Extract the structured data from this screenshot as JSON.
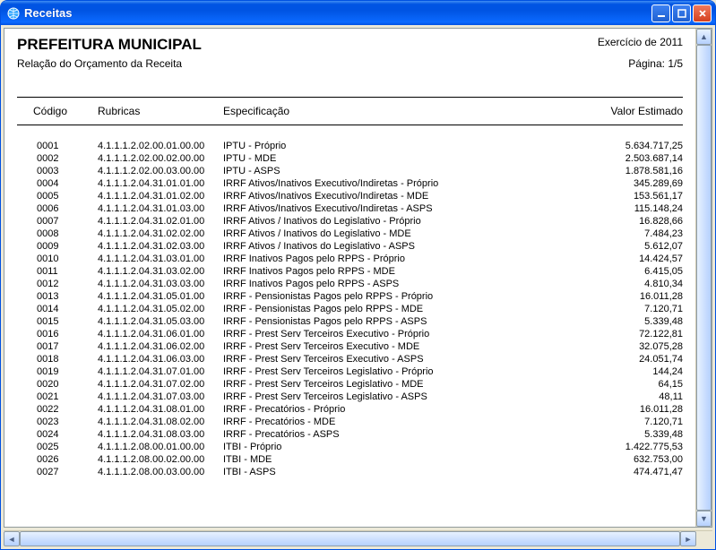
{
  "window": {
    "title": "Receitas"
  },
  "report": {
    "org": "PREFEITURA MUNICIPAL",
    "subtitle": "Relação do Orçamento da Receita",
    "exercise": "Exercício de 2011",
    "page": "Página: 1/5"
  },
  "columns": {
    "codigo": "Código",
    "rubricas": "Rubricas",
    "especificacao": "Especificação",
    "valor": "Valor Estimado"
  },
  "rows": [
    {
      "codigo": "0001",
      "rubrica": "4.1.1.1.2.02.00.01.00.00",
      "espec": "IPTU - Próprio",
      "valor": "5.634.717,25"
    },
    {
      "codigo": "0002",
      "rubrica": "4.1.1.1.2.02.00.02.00.00",
      "espec": "IPTU - MDE",
      "valor": "2.503.687,14"
    },
    {
      "codigo": "0003",
      "rubrica": "4.1.1.1.2.02.00.03.00.00",
      "espec": "IPTU - ASPS",
      "valor": "1.878.581,16"
    },
    {
      "codigo": "0004",
      "rubrica": "4.1.1.1.2.04.31.01.01.00",
      "espec": "IRRF Ativos/Inativos Executivo/Indiretas - Próprio",
      "valor": "345.289,69"
    },
    {
      "codigo": "0005",
      "rubrica": "4.1.1.1.2.04.31.01.02.00",
      "espec": "IRRF Ativos/Inativos Executivo/Indiretas - MDE",
      "valor": "153.561,17"
    },
    {
      "codigo": "0006",
      "rubrica": "4.1.1.1.2.04.31.01.03.00",
      "espec": "IRRF Ativos/Inativos Executivo/Indiretas - ASPS",
      "valor": "115.148,24"
    },
    {
      "codigo": "0007",
      "rubrica": "4.1.1.1.2.04.31.02.01.00",
      "espec": "IRRF Ativos / Inativos do Legislativo - Próprio",
      "valor": "16.828,66"
    },
    {
      "codigo": "0008",
      "rubrica": "4.1.1.1.2.04.31.02.02.00",
      "espec": "IRRF Ativos / Inativos do Legislativo - MDE",
      "valor": "7.484,23"
    },
    {
      "codigo": "0009",
      "rubrica": "4.1.1.1.2.04.31.02.03.00",
      "espec": "IRRF Ativos / Inativos do Legislativo -  ASPS",
      "valor": "5.612,07"
    },
    {
      "codigo": "0010",
      "rubrica": "4.1.1.1.2.04.31.03.01.00",
      "espec": "IRRF Inativos Pagos pelo RPPS - Próprio",
      "valor": "14.424,57"
    },
    {
      "codigo": "0011",
      "rubrica": "4.1.1.1.2.04.31.03.02.00",
      "espec": "IRRF Inativos Pagos pelo RPPS - MDE",
      "valor": "6.415,05"
    },
    {
      "codigo": "0012",
      "rubrica": "4.1.1.1.2.04.31.03.03.00",
      "espec": "IRRF Inativos Pagos pelo RPPS - ASPS",
      "valor": "4.810,34"
    },
    {
      "codigo": "0013",
      "rubrica": "4.1.1.1.2.04.31.05.01.00",
      "espec": "IRRF - Pensionistas Pagos pelo RPPS - Próprio",
      "valor": "16.011,28"
    },
    {
      "codigo": "0014",
      "rubrica": "4.1.1.1.2.04.31.05.02.00",
      "espec": "IRRF - Pensionistas Pagos pelo RPPS - MDE",
      "valor": "7.120,71"
    },
    {
      "codigo": "0015",
      "rubrica": "4.1.1.1.2.04.31.05.03.00",
      "espec": "IRRF - Pensionistas Pagos pelo RPPS - ASPS",
      "valor": "5.339,48"
    },
    {
      "codigo": "0016",
      "rubrica": "4.1.1.1.2.04.31.06.01.00",
      "espec": "IRRF - Prest Serv Terceiros Executivo - Próprio",
      "valor": "72.122,81"
    },
    {
      "codigo": "0017",
      "rubrica": "4.1.1.1.2.04.31.06.02.00",
      "espec": "IRRF - Prest Serv Terceiros Executivo - MDE",
      "valor": "32.075,28"
    },
    {
      "codigo": "0018",
      "rubrica": "4.1.1.1.2.04.31.06.03.00",
      "espec": "IRRF - Prest Serv Terceiros Executivo - ASPS",
      "valor": "24.051,74"
    },
    {
      "codigo": "0019",
      "rubrica": "4.1.1.1.2.04.31.07.01.00",
      "espec": "IRRF - Prest Serv Terceiros Legislativo - Próprio",
      "valor": "144,24"
    },
    {
      "codigo": "0020",
      "rubrica": "4.1.1.1.2.04.31.07.02.00",
      "espec": "IRRF - Prest Serv Terceiros Legislativo - MDE",
      "valor": "64,15"
    },
    {
      "codigo": "0021",
      "rubrica": "4.1.1.1.2.04.31.07.03.00",
      "espec": "IRRF - Prest Serv Terceiros Legislativo - ASPS",
      "valor": "48,11"
    },
    {
      "codigo": "0022",
      "rubrica": "4.1.1.1.2.04.31.08.01.00",
      "espec": "IRRF - Precatórios - Próprio",
      "valor": "16.011,28"
    },
    {
      "codigo": "0023",
      "rubrica": "4.1.1.1.2.04.31.08.02.00",
      "espec": "IRRF - Precatórios - MDE",
      "valor": "7.120,71"
    },
    {
      "codigo": "0024",
      "rubrica": "4.1.1.1.2.04.31.08.03.00",
      "espec": "IRRF - Precatórios - ASPS",
      "valor": "5.339,48"
    },
    {
      "codigo": "0025",
      "rubrica": "4.1.1.1.2.08.00.01.00.00",
      "espec": "ITBI - Próprio",
      "valor": "1.422.775,53"
    },
    {
      "codigo": "0026",
      "rubrica": "4.1.1.1.2.08.00.02.00.00",
      "espec": "ITBI - MDE",
      "valor": "632.753,00"
    },
    {
      "codigo": "0027",
      "rubrica": "4.1.1.1.2.08.00.03.00.00",
      "espec": "ITBI - ASPS",
      "valor": "474.471,47"
    }
  ]
}
